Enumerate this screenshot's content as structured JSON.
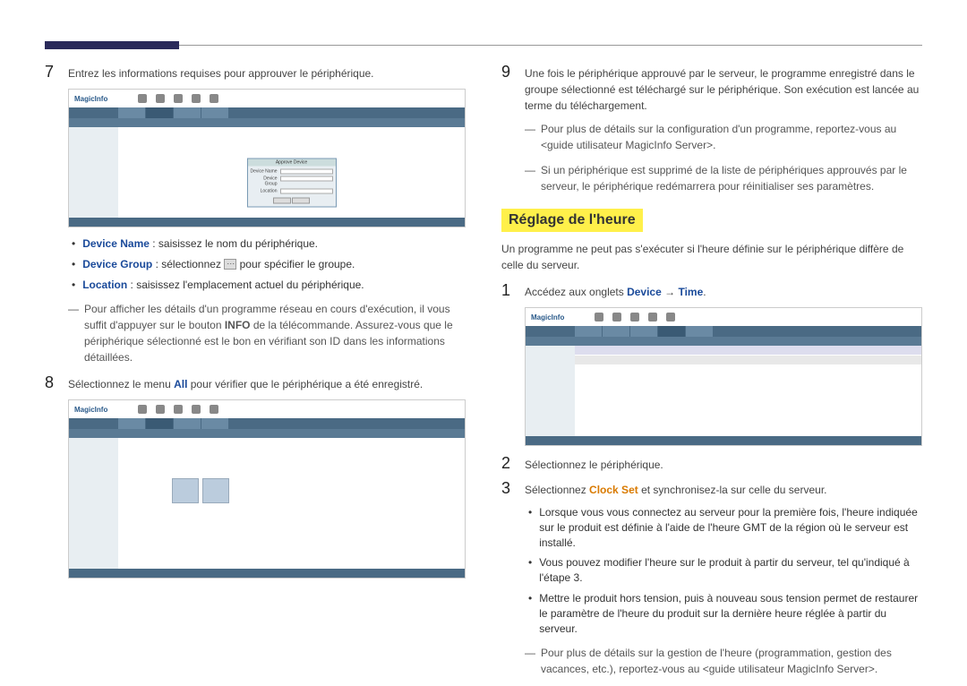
{
  "left": {
    "step7": "Entrez les informations requises pour approuver le périphérique.",
    "bullet1_label": "Device Name",
    "bullet1_text": " : saisissez le nom du périphérique.",
    "bullet2_label": "Device Group",
    "bullet2_text_a": " : sélectionnez ",
    "bullet2_text_b": " pour spécifier le groupe.",
    "bullet3_label": "Location",
    "bullet3_text": " : saisissez l'emplacement actuel du périphérique.",
    "note1_a": "Pour afficher les détails d'un programme réseau en cours d'exécution, il vous suffit d'appuyer sur le bouton ",
    "note1_b": "INFO",
    "note1_c": " de la télécommande. Assurez-vous que le périphérique sélectionné est le bon en vérifiant son ID dans les informations détaillées.",
    "step8_a": "Sélectionnez le menu ",
    "step8_b": "All",
    "step8_c": " pour vérifier que le périphérique a été enregistré."
  },
  "right": {
    "step9": "Une fois le périphérique approuvé par le serveur, le programme enregistré dans le groupe sélectionné est téléchargé sur le périphérique. Son exécution est lancée au terme du téléchargement.",
    "note2": "Pour plus de détails sur la configuration d'un programme, reportez-vous au <guide utilisateur MagicInfo Server>.",
    "note3": "Si un périphérique est supprimé de la liste de périphériques approuvés par le serveur, le périphérique redémarrera pour réinitialiser ses paramètres.",
    "heading": "Réglage de l'heure",
    "intro": "Un programme ne peut pas s'exécuter si l'heure définie sur le périphérique diffère de celle du serveur.",
    "step1_a": "Accédez aux onglets ",
    "step1_b": "Device",
    "step1_arrow": " → ",
    "step1_c": "Time",
    "step1_d": ".",
    "step2": "Sélectionnez le périphérique.",
    "step3_a": "Sélectionnez ",
    "step3_b": "Clock Set",
    "step3_c": " et synchronisez-la sur celle du serveur.",
    "sb1": "Lorsque vous vous connectez au serveur pour la première fois, l'heure indiquée sur le produit est définie à l'aide de l'heure GMT de la région où le serveur est installé.",
    "sb2": "Vous pouvez modifier l'heure sur le produit à partir du serveur, tel qu'indiqué à l'étape 3.",
    "sb3": "Mettre le produit hors tension, puis à nouveau sous tension permet de restaurer le paramètre de l'heure du produit sur la dernière heure réglée à partir du serveur.",
    "note4": "Pour plus de détails sur la gestion de l'heure (programmation, gestion des vacances, etc.), reportez-vous au <guide utilisateur MagicInfo Server>."
  },
  "ss": {
    "logo": "MagicInfo",
    "dlg_title": "Approve Device",
    "dlg_name": "Device Name",
    "dlg_group": "Device Group",
    "dlg_loc": "Location"
  }
}
